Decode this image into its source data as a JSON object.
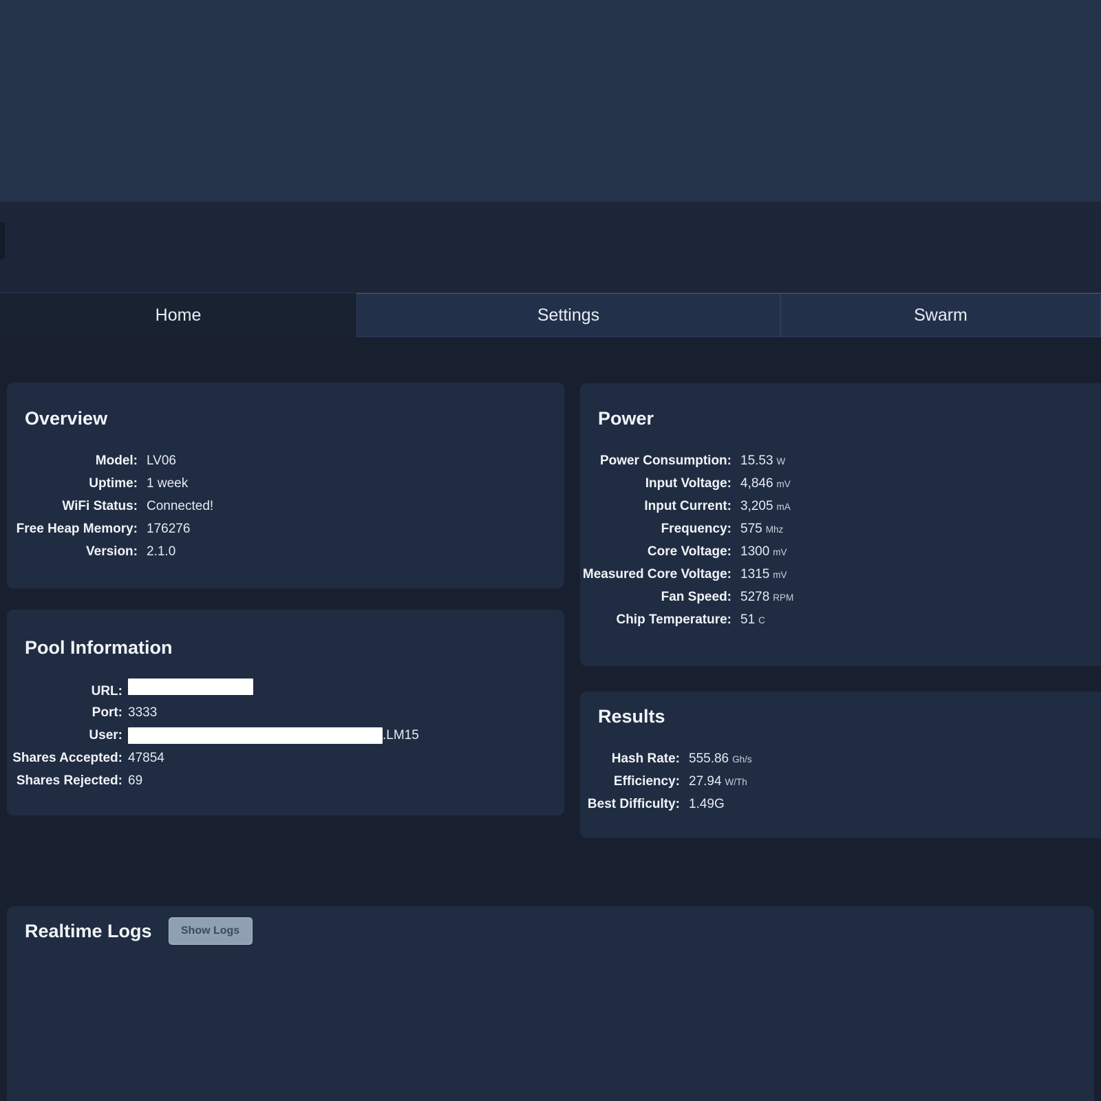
{
  "tabs": [
    {
      "label": "Home",
      "active": true
    },
    {
      "label": "Settings",
      "active": false
    },
    {
      "label": "Swarm",
      "active": false
    }
  ],
  "cards": {
    "overview": {
      "title": "Overview",
      "rows": [
        {
          "label": "Model:",
          "value": "LV06"
        },
        {
          "label": "Uptime:",
          "value": "1 week"
        },
        {
          "label": "WiFi Status:",
          "value": "Connected!"
        },
        {
          "label": "Free Heap Memory:",
          "value": "176276"
        },
        {
          "label": "Version:",
          "value": "2.1.0"
        }
      ]
    },
    "power": {
      "title": "Power",
      "rows": [
        {
          "label": "Power Consumption:",
          "value": "15.53",
          "unit": "W"
        },
        {
          "label": "Input Voltage:",
          "value": "4,846",
          "unit": "mV"
        },
        {
          "label": "Input Current:",
          "value": "3,205",
          "unit": "mA"
        },
        {
          "label": "Frequency:",
          "value": "575",
          "unit": "Mhz"
        },
        {
          "label": "Core Voltage:",
          "value": "1300",
          "unit": "mV"
        },
        {
          "label": "Measured Core Voltage:",
          "value": "1315",
          "unit": "mV"
        },
        {
          "label": "Fan Speed:",
          "value": "5278",
          "unit": "RPM"
        },
        {
          "label": "Chip Temperature:",
          "value": "51",
          "unit": "C"
        }
      ]
    },
    "pool": {
      "title": "Pool Information",
      "rows": [
        {
          "label": "URL:",
          "redacted": true,
          "redact_width": 182
        },
        {
          "label": "Port:",
          "value": "3333"
        },
        {
          "label": "User:",
          "redacted": true,
          "redact_width": 370,
          "suffix": ".LM15"
        },
        {
          "label": "Shares Accepted:",
          "value": "47854"
        },
        {
          "label": "Shares Rejected:",
          "value": "69"
        }
      ]
    },
    "results": {
      "title": "Results",
      "rows": [
        {
          "label": "Hash Rate:",
          "value": "555.86",
          "unit": "Gh/s"
        },
        {
          "label": "Efficiency:",
          "value": "27.94",
          "unit": "W/Th"
        },
        {
          "label": "Best Difficulty:",
          "value": "1.49G"
        }
      ]
    },
    "logs": {
      "title": "Realtime Logs",
      "button_label": "Show Logs"
    }
  },
  "colors": {
    "page_bg": "#18202F",
    "hero_bg": "#243349",
    "bar_bg": "#1C2638",
    "tab_row_bg": "#192231",
    "tab_box_bg": "#22304A",
    "tab_border": "#2E3D58",
    "card_bg": "#202C42",
    "text": "#F1F4F8",
    "value_text": "#E6EBF2",
    "unit_text": "#C9D2DE",
    "button_bg": "#8FA0B2",
    "button_text": "#394A61",
    "redaction": "#FFFFFF"
  }
}
